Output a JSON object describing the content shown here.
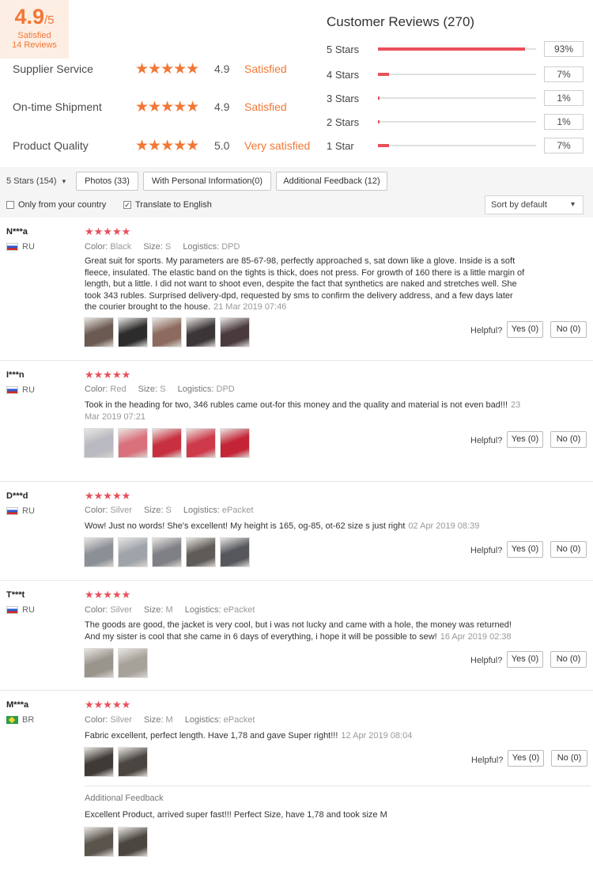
{
  "summary": {
    "score": "4.9",
    "score_of": "/5",
    "satisfied": "Satisfied",
    "reviews_count": "14 Reviews",
    "metrics": [
      {
        "label": "Supplier Service",
        "stars": "★★★★★",
        "score": "4.9",
        "verdict": "Satisfied"
      },
      {
        "label": "On-time Shipment",
        "stars": "★★★★★",
        "score": "4.9",
        "verdict": "Satisfied"
      },
      {
        "label": "Product Quality",
        "stars": "★★★★★",
        "score": "5.0",
        "verdict": "Very satisfied"
      }
    ]
  },
  "customer_reviews": {
    "title": "Customer Reviews (270)",
    "rows": [
      {
        "label": "5 Stars",
        "percent": "93%",
        "fill": 0.93
      },
      {
        "label": "4 Stars",
        "percent": "7%",
        "fill": 0.07
      },
      {
        "label": "3 Stars",
        "percent": "1%",
        "fill": 0.01
      },
      {
        "label": "2 Stars",
        "percent": "1%",
        "fill": 0.01
      },
      {
        "label": "1 Star",
        "percent": "7%",
        "fill": 0.07
      }
    ]
  },
  "filters": {
    "star_filter": "5 Stars (154)",
    "star_caret": "▾",
    "photos": "Photos (33)",
    "personal": "With Personal Information(0)",
    "additional": "Additional Feedback (12)",
    "only_country": "Only from your country",
    "translate": "Translate to English",
    "translate_check": "✓",
    "sort": "Sort by default",
    "sort_caret": "▾"
  },
  "labels": {
    "helpful": "Helpful?",
    "color": "Color:",
    "size": "Size:",
    "logistics": "Logistics:"
  },
  "reviews": [
    {
      "name": "N***a",
      "country": "RU",
      "stars": "★★★★★",
      "color": "Black",
      "size": "S",
      "logistics": "DPD",
      "text": "Great suit for sports. My parameters are 85-67-98, perfectly approached s, sat down like a glove. Inside is a soft fleece, insulated. The elastic band on the tights is thick, does not press. For growth of 160 there is a little margin of length, but a little. I did not want to shoot even, despite the fact that synthetics are naked and stretches well. She took 343 rubles. Surprised delivery-dpd, requested by sms to confirm the delivery address, and a few days later the courier brought to the house.",
      "date": "21 Mar 2019 07:46",
      "yes": "Yes (0)",
      "no": "No (0)",
      "thumb_colors": [
        "#6b5a52",
        "#2c2c2c",
        "#8c6a5e",
        "#3a3536",
        "#4a3a3e"
      ]
    },
    {
      "name": "I***n",
      "country": "RU",
      "stars": "★★★★★",
      "color": "Red",
      "size": "S",
      "logistics": "DPD",
      "text": "Took in the heading for two, 346 rubles came out-for this money and the quality and material is not even bad!!!",
      "date": "23 Mar 2019 07:21",
      "yes": "Yes (0)",
      "no": "No (0)",
      "thumb_colors": [
        "#b9b9c2",
        "#d9707c",
        "#c8303f",
        "#cf3a4a",
        "#c42436"
      ]
    },
    {
      "name": "D***d",
      "country": "RU",
      "stars": "★★★★★",
      "color": "Silver",
      "size": "S",
      "logistics": "ePacket",
      "text": "Wow! Just no words! She's excellent! My height is 165, og-85, ot-62 size s just right",
      "date": "02 Apr 2019 08:39",
      "yes": "Yes (0)",
      "no": "No (0)",
      "thumb_colors": [
        "#8b8f96",
        "#9fa4aa",
        "#7f7f86",
        "#5f5b58",
        "#55575d"
      ]
    },
    {
      "name": "T***t",
      "country": "RU",
      "stars": "★★★★★",
      "color": "Silver",
      "size": "M",
      "logistics": "ePacket",
      "text": "The goods are good, the jacket is very cool, but i was not lucky and came with a hole, the money was returned! And my sister is cool that she came in 6 days of everything, i hope it will be possible to sew!",
      "date": "16 Apr 2019 02:38",
      "yes": "Yes (0)",
      "no": "No (0)",
      "thumb_colors": [
        "#9a958c",
        "#a6a199"
      ]
    },
    {
      "name": "M***a",
      "country": "BR",
      "stars": "★★★★★",
      "color": "Silver",
      "size": "M",
      "logistics": "ePacket",
      "text": "Fabric excellent, perfect length. Have 1,78 and gave Super right!!!",
      "date": "12 Apr 2019 08:04",
      "yes": "Yes (0)",
      "no": "No (0)",
      "thumb_colors": [
        "#3f3a36",
        "#4a4540"
      ],
      "additional_title": "Additional Feedback",
      "additional_text": "Excellent Product, arrived super fast!!! Perfect Size, have 1,78 and took size M",
      "additional_thumb_colors": [
        "#5a544d",
        "#4b4640"
      ]
    }
  ]
}
